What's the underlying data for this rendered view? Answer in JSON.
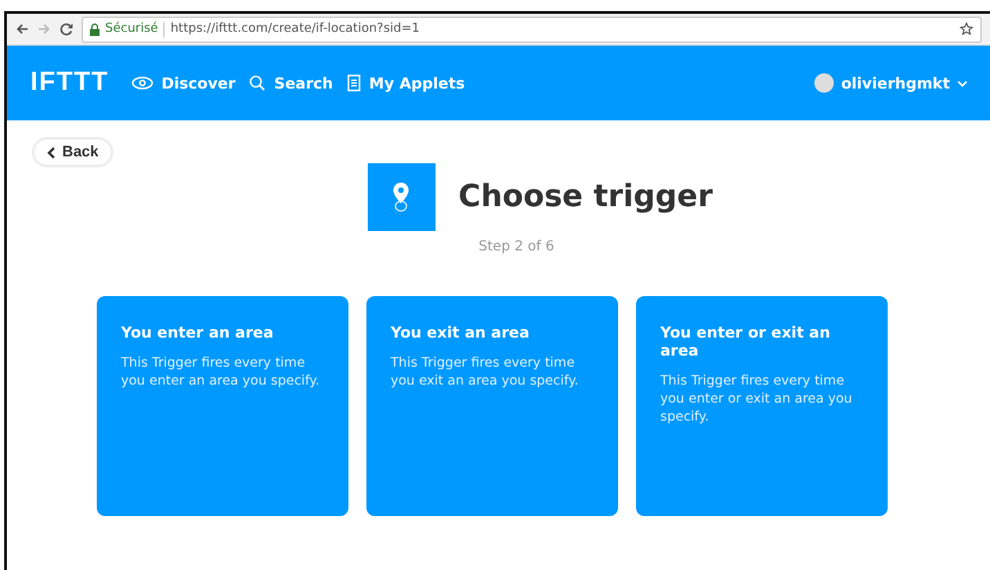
{
  "browser": {
    "security_label": "Sécurisé",
    "url": "https://ifttt.com/create/if-location?sid=1"
  },
  "nav": {
    "logo": "IFTTT",
    "links": [
      {
        "kind": "eye",
        "label": "Discover"
      },
      {
        "kind": "search",
        "label": "Search"
      },
      {
        "kind": "doc",
        "label": "My Applets"
      }
    ],
    "user": "olivierhgmkt"
  },
  "back_button": "Back",
  "header": {
    "title": "Choose trigger",
    "step": "Step 2 of 6"
  },
  "triggers": [
    {
      "title": "You enter an area",
      "description": "This Trigger fires every time you enter an area you specify."
    },
    {
      "title": "You exit an area",
      "description": "This Trigger fires every time you exit an area you specify."
    },
    {
      "title": "You enter or exit an area",
      "description": "This Trigger fires every time you enter or exit an area you specify."
    }
  ]
}
